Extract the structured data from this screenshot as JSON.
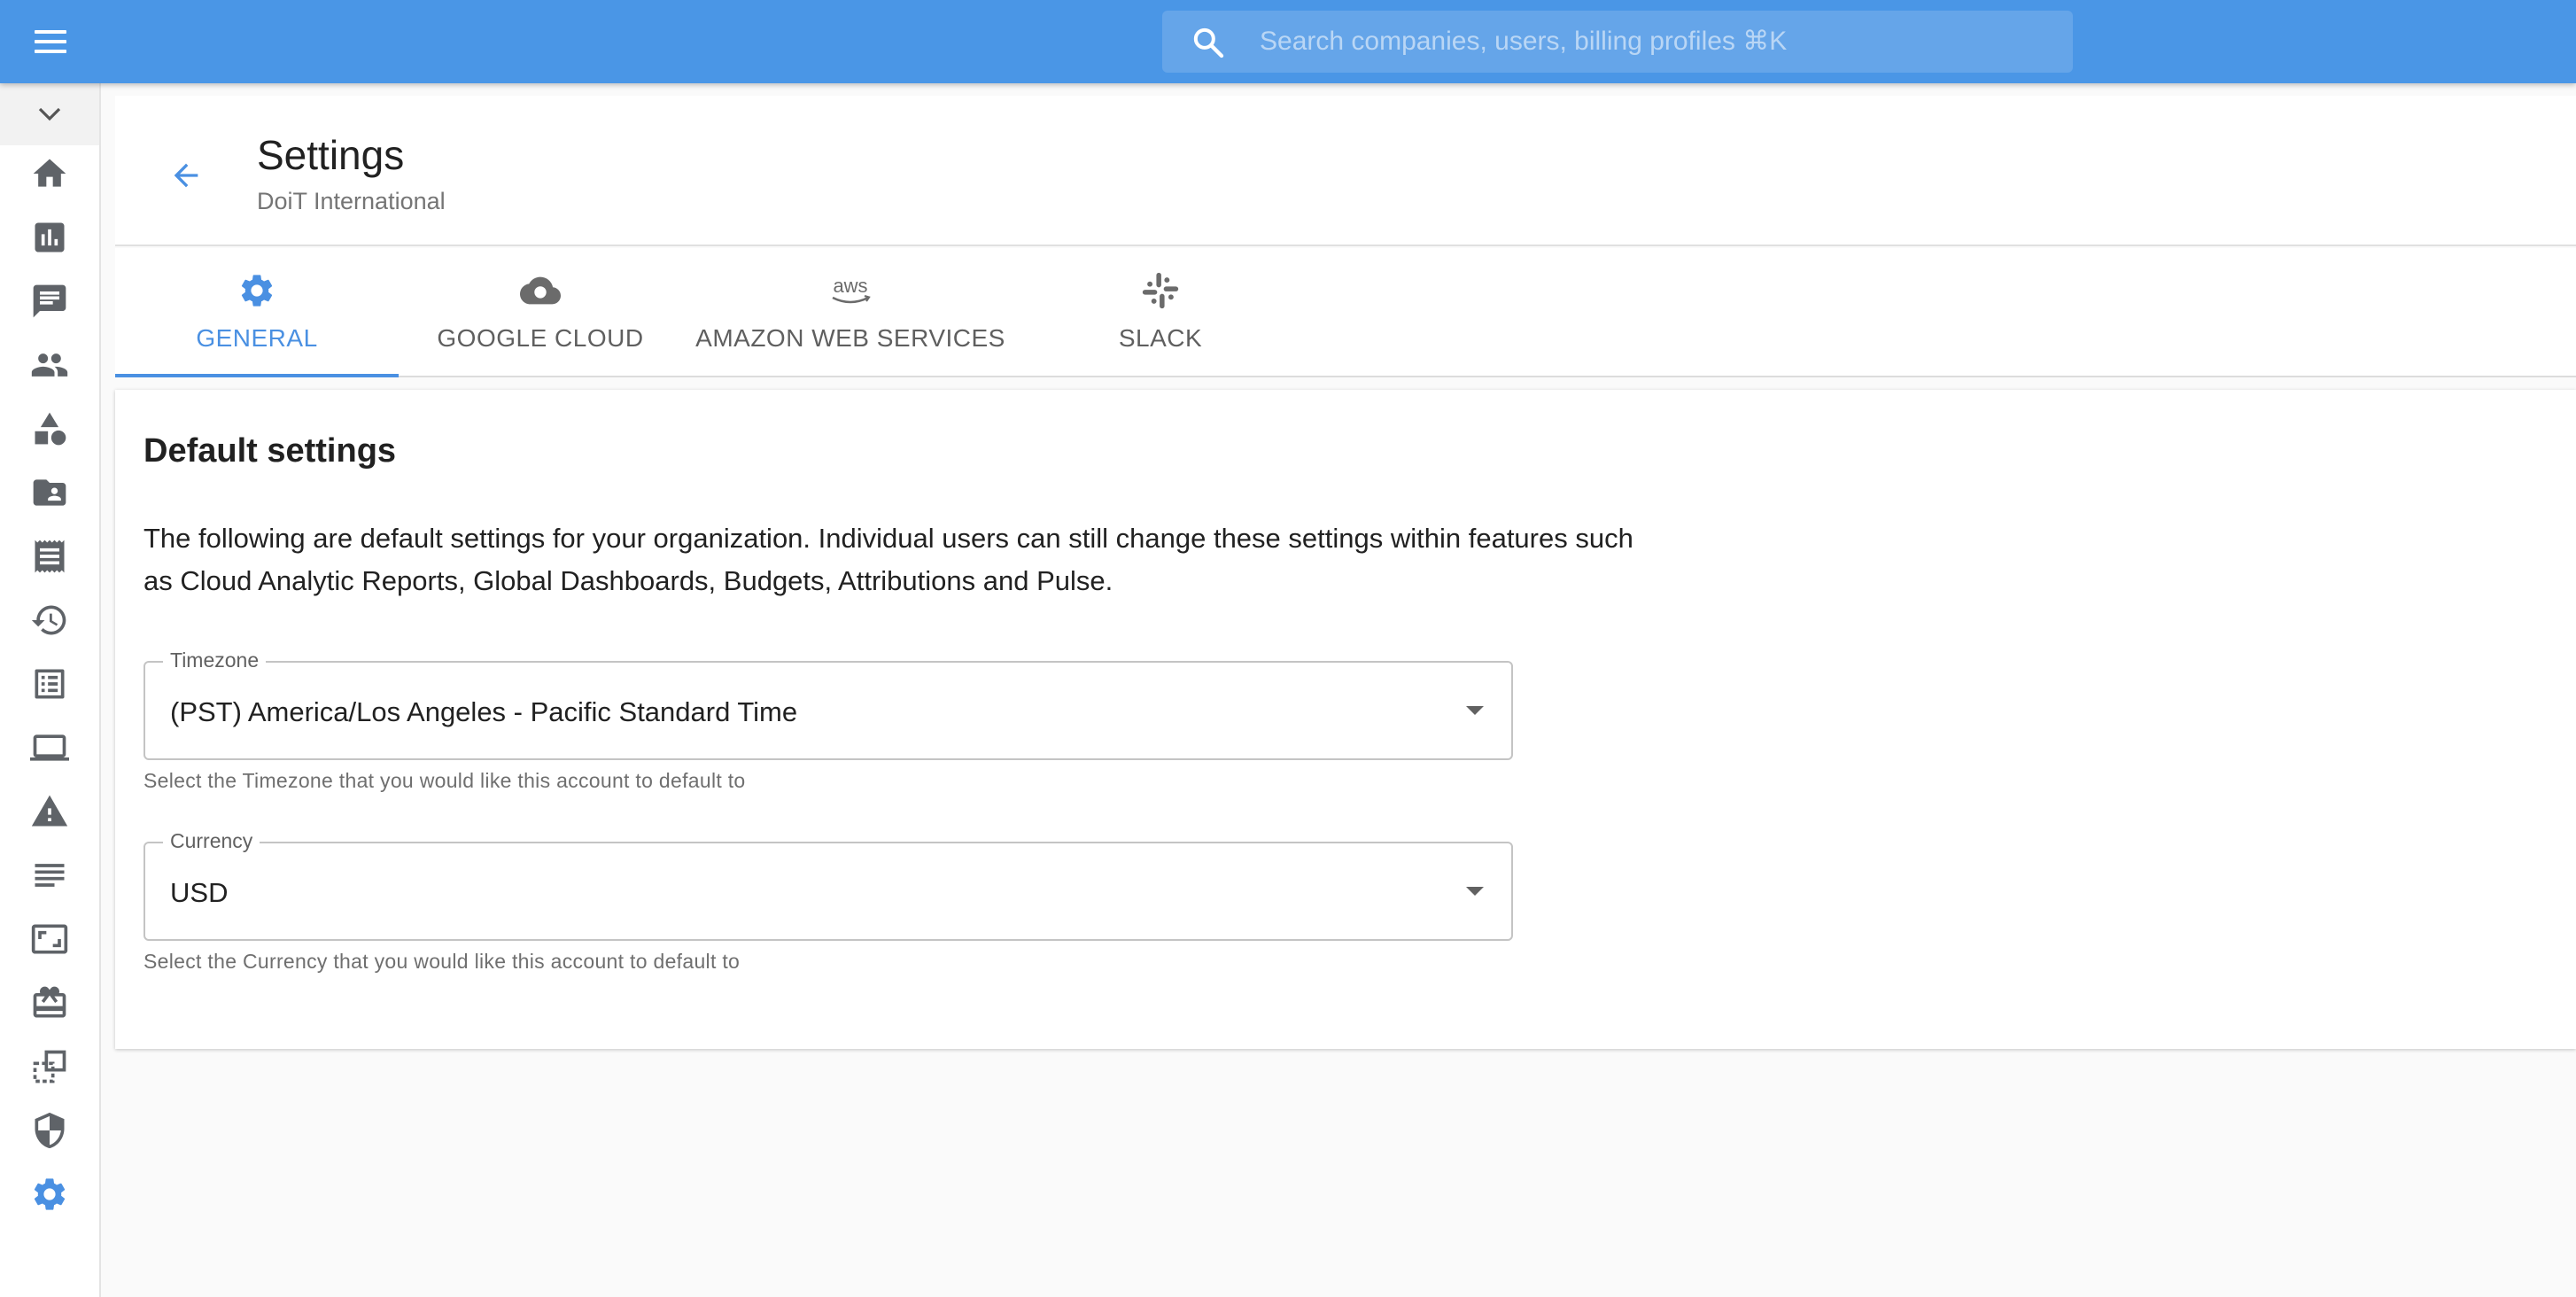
{
  "topbar": {
    "search_placeholder": "Search companies, users, billing profiles ⌘K",
    "accent_color": "#4a96e6"
  },
  "sidebar": {
    "items": [
      {
        "icon": "home-icon"
      },
      {
        "icon": "bar-chart-icon"
      },
      {
        "icon": "chat-icon"
      },
      {
        "icon": "people-icon"
      },
      {
        "icon": "shapes-icon"
      },
      {
        "icon": "folder-user-icon"
      },
      {
        "icon": "receipt-icon"
      },
      {
        "icon": "history-icon"
      },
      {
        "icon": "list-icon"
      },
      {
        "icon": "laptop-icon"
      },
      {
        "icon": "warning-icon"
      },
      {
        "icon": "lines-icon"
      },
      {
        "icon": "aspect-ratio-icon"
      },
      {
        "icon": "gift-card-icon"
      },
      {
        "icon": "flip-icon"
      },
      {
        "icon": "shield-icon"
      },
      {
        "icon": "gear-icon",
        "active": true
      }
    ]
  },
  "header": {
    "title": "Settings",
    "subtitle": "DoiT International"
  },
  "tabs": [
    {
      "label": "GENERAL",
      "icon": "gear-icon",
      "active": true
    },
    {
      "label": "GOOGLE CLOUD",
      "icon": "cloud-icon"
    },
    {
      "label": "AMAZON WEB SERVICES",
      "icon": "aws-icon",
      "icon_text": "aws"
    },
    {
      "label": "SLACK",
      "icon": "slack-icon"
    }
  ],
  "main": {
    "title": "Default settings",
    "description": "The following are default settings for your organization. Individual users can still change these settings within features such as Cloud Analytic Reports, Global Dashboards, Budgets, Attributions and Pulse.",
    "timezone": {
      "label": "Timezone",
      "value": "(PST) America/Los Angeles - Pacific Standard Time",
      "helper": "Select the Timezone that you would like this account to default to"
    },
    "currency": {
      "label": "Currency",
      "value": "USD",
      "helper": "Select the Currency that you would like this account to default to"
    }
  }
}
